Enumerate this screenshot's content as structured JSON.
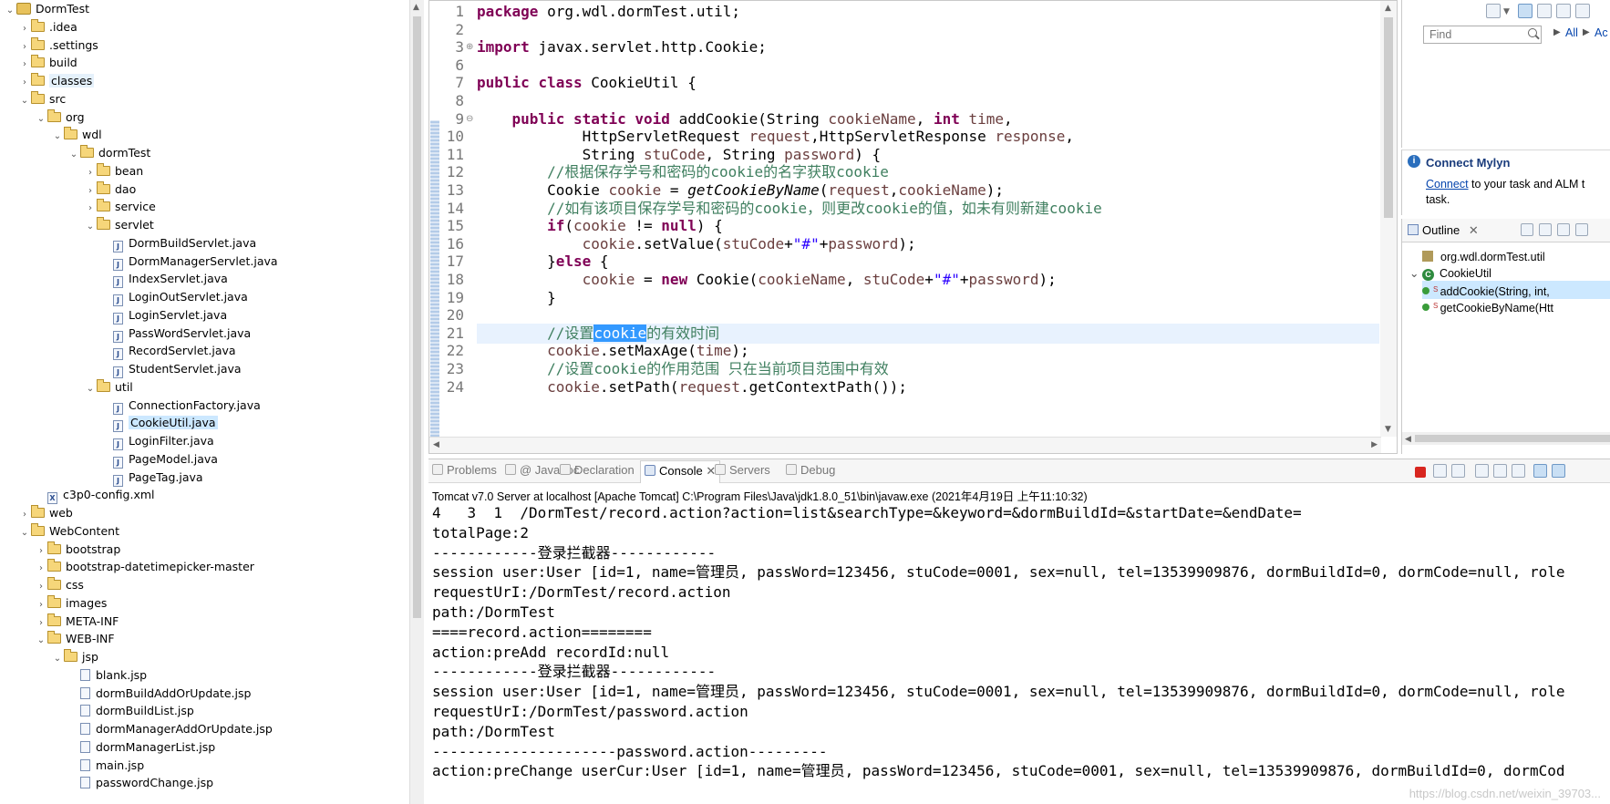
{
  "explorer": {
    "items": [
      {
        "label": "DormTest",
        "depth": 0,
        "type": "project",
        "expanded": true
      },
      {
        "label": ".idea",
        "depth": 1,
        "type": "folder",
        "expanded": false
      },
      {
        "label": ".settings",
        "depth": 1,
        "type": "folder",
        "expanded": false
      },
      {
        "label": "build",
        "depth": 1,
        "type": "folder",
        "expanded": false
      },
      {
        "label": "classes",
        "depth": 1,
        "type": "folder",
        "expanded": false,
        "highlight": true
      },
      {
        "label": "src",
        "depth": 1,
        "type": "folder",
        "expanded": true
      },
      {
        "label": "org",
        "depth": 2,
        "type": "folder",
        "expanded": true
      },
      {
        "label": "wdl",
        "depth": 3,
        "type": "folder",
        "expanded": true
      },
      {
        "label": "dormTest",
        "depth": 4,
        "type": "folder",
        "expanded": true
      },
      {
        "label": "bean",
        "depth": 5,
        "type": "folder",
        "expanded": false
      },
      {
        "label": "dao",
        "depth": 5,
        "type": "folder",
        "expanded": false
      },
      {
        "label": "service",
        "depth": 5,
        "type": "folder",
        "expanded": false
      },
      {
        "label": "servlet",
        "depth": 5,
        "type": "folder",
        "expanded": true
      },
      {
        "label": "DormBuildServlet.java",
        "depth": 6,
        "type": "java"
      },
      {
        "label": "DormManagerServlet.java",
        "depth": 6,
        "type": "java"
      },
      {
        "label": "IndexServlet.java",
        "depth": 6,
        "type": "java"
      },
      {
        "label": "LoginOutServlet.java",
        "depth": 6,
        "type": "java"
      },
      {
        "label": "LoginServlet.java",
        "depth": 6,
        "type": "java"
      },
      {
        "label": "PassWordServlet.java",
        "depth": 6,
        "type": "java"
      },
      {
        "label": "RecordServlet.java",
        "depth": 6,
        "type": "java"
      },
      {
        "label": "StudentServlet.java",
        "depth": 6,
        "type": "java"
      },
      {
        "label": "util",
        "depth": 5,
        "type": "folder",
        "expanded": true
      },
      {
        "label": "ConnectionFactory.java",
        "depth": 6,
        "type": "java"
      },
      {
        "label": "CookieUtil.java",
        "depth": 6,
        "type": "java",
        "selected": true
      },
      {
        "label": "LoginFilter.java",
        "depth": 6,
        "type": "java"
      },
      {
        "label": "PageModel.java",
        "depth": 6,
        "type": "java"
      },
      {
        "label": "PageTag.java",
        "depth": 6,
        "type": "java"
      },
      {
        "label": "c3p0-config.xml",
        "depth": 2,
        "type": "xml"
      },
      {
        "label": "web",
        "depth": 1,
        "type": "folder",
        "expanded": false
      },
      {
        "label": "WebContent",
        "depth": 1,
        "type": "folder",
        "expanded": true
      },
      {
        "label": "bootstrap",
        "depth": 2,
        "type": "folder",
        "expanded": false
      },
      {
        "label": "bootstrap-datetimepicker-master",
        "depth": 2,
        "type": "folder",
        "expanded": false
      },
      {
        "label": "css",
        "depth": 2,
        "type": "folder",
        "expanded": false
      },
      {
        "label": "images",
        "depth": 2,
        "type": "folder",
        "expanded": false
      },
      {
        "label": "META-INF",
        "depth": 2,
        "type": "folder",
        "expanded": false
      },
      {
        "label": "WEB-INF",
        "depth": 2,
        "type": "folder",
        "expanded": true
      },
      {
        "label": "jsp",
        "depth": 3,
        "type": "folder",
        "expanded": true
      },
      {
        "label": "blank.jsp",
        "depth": 4,
        "type": "jsp"
      },
      {
        "label": "dormBuildAddOrUpdate.jsp",
        "depth": 4,
        "type": "jsp"
      },
      {
        "label": "dormBuildList.jsp",
        "depth": 4,
        "type": "jsp"
      },
      {
        "label": "dormManagerAddOrUpdate.jsp",
        "depth": 4,
        "type": "jsp"
      },
      {
        "label": "dormManagerList.jsp",
        "depth": 4,
        "type": "jsp"
      },
      {
        "label": "main.jsp",
        "depth": 4,
        "type": "jsp"
      },
      {
        "label": "passwordChange.jsp",
        "depth": 4,
        "type": "jsp"
      }
    ]
  },
  "editor": {
    "line_numbers": [
      "1",
      "2",
      "3",
      "6",
      "7",
      "8",
      "9",
      "10",
      "11",
      "12",
      "13",
      "14",
      "15",
      "16",
      "17",
      "18",
      "19",
      "20",
      "21",
      "22",
      "23",
      "24"
    ],
    "lines": [
      [
        {
          "t": "package ",
          "c": "kw"
        },
        {
          "t": "org.wdl.dormTest.util;"
        }
      ],
      [],
      [
        {
          "t": "import ",
          "c": "kw"
        },
        {
          "t": "javax.servlet.http.Cookie;"
        }
      ],
      [],
      [
        {
          "t": "public ",
          "c": "kw"
        },
        {
          "t": "class ",
          "c": "kw"
        },
        {
          "t": "CookieUtil {"
        }
      ],
      [],
      [
        {
          "t": "    "
        },
        {
          "t": "public ",
          "c": "kw"
        },
        {
          "t": "static ",
          "c": "kw"
        },
        {
          "t": "void ",
          "c": "kw"
        },
        {
          "t": "addCookie(String "
        },
        {
          "t": "cookieName",
          "c": "var"
        },
        {
          "t": ", "
        },
        {
          "t": "int ",
          "c": "kw"
        },
        {
          "t": "time",
          "c": "var"
        },
        {
          "t": ","
        }
      ],
      [
        {
          "t": "            HttpServletRequest "
        },
        {
          "t": "request",
          "c": "var"
        },
        {
          "t": ",HttpServletResponse "
        },
        {
          "t": "response",
          "c": "var"
        },
        {
          "t": ","
        }
      ],
      [
        {
          "t": "            String "
        },
        {
          "t": "stuCode",
          "c": "var"
        },
        {
          "t": ", String "
        },
        {
          "t": "password",
          "c": "var"
        },
        {
          "t": ") {"
        }
      ],
      [
        {
          "t": "        "
        },
        {
          "t": "//根据保存学号和密码的cookie的名字获取cookie",
          "c": "cm"
        }
      ],
      [
        {
          "t": "        Cookie "
        },
        {
          "t": "cookie",
          "c": "var"
        },
        {
          "t": " = "
        },
        {
          "t": "getCookieByName",
          "c": "it"
        },
        {
          "t": "("
        },
        {
          "t": "request",
          "c": "var"
        },
        {
          "t": ","
        },
        {
          "t": "cookieName",
          "c": "var"
        },
        {
          "t": ");"
        }
      ],
      [
        {
          "t": "        "
        },
        {
          "t": "//如有该项目保存学号和密码的cookie，则更改cookie的值，如未有则新建cookie",
          "c": "cm"
        }
      ],
      [
        {
          "t": "        "
        },
        {
          "t": "if",
          "c": "kw"
        },
        {
          "t": "("
        },
        {
          "t": "cookie",
          "c": "var"
        },
        {
          "t": " != "
        },
        {
          "t": "null",
          "c": "kw"
        },
        {
          "t": ") {"
        }
      ],
      [
        {
          "t": "            "
        },
        {
          "t": "cookie",
          "c": "var"
        },
        {
          "t": ".setValue("
        },
        {
          "t": "stuCode",
          "c": "var"
        },
        {
          "t": "+"
        },
        {
          "t": "\"#\"",
          "c": "str"
        },
        {
          "t": "+"
        },
        {
          "t": "password",
          "c": "var"
        },
        {
          "t": ");"
        }
      ],
      [
        {
          "t": "        }"
        },
        {
          "t": "else ",
          "c": "kw"
        },
        {
          "t": "{"
        }
      ],
      [
        {
          "t": "            "
        },
        {
          "t": "cookie",
          "c": "var"
        },
        {
          "t": " = "
        },
        {
          "t": "new ",
          "c": "kw"
        },
        {
          "t": "Cookie("
        },
        {
          "t": "cookieName",
          "c": "var"
        },
        {
          "t": ", "
        },
        {
          "t": "stuCode",
          "c": "var"
        },
        {
          "t": "+"
        },
        {
          "t": "\"#\"",
          "c": "str"
        },
        {
          "t": "+"
        },
        {
          "t": "password",
          "c": "var"
        },
        {
          "t": ");"
        }
      ],
      [
        {
          "t": "        }"
        }
      ],
      [],
      [
        {
          "t": "        "
        },
        {
          "t": "//设置",
          "c": "cm"
        },
        {
          "t": "cookie",
          "c": "sel"
        },
        {
          "t": "的有效时间",
          "c": "cm"
        }
      ],
      [
        {
          "t": "        "
        },
        {
          "t": "cookie",
          "c": "var"
        },
        {
          "t": ".setMaxAge("
        },
        {
          "t": "time",
          "c": "var"
        },
        {
          "t": ");"
        }
      ],
      [
        {
          "t": "        "
        },
        {
          "t": "//设置cookie的作用范围 只在当前项目范围中有效",
          "c": "cm"
        }
      ],
      [
        {
          "t": "        "
        },
        {
          "t": "cookie",
          "c": "var"
        },
        {
          "t": ".setPath("
        },
        {
          "t": "request",
          "c": "var"
        },
        {
          "t": ".getContextPath());"
        }
      ]
    ]
  },
  "tasklist": {
    "find_placeholder": "Find",
    "all_label": "All",
    "activate_label": "Ac"
  },
  "mylyn": {
    "title": "Connect Mylyn",
    "link": "Connect",
    "text": " to your task and ALM t",
    "text2": "task."
  },
  "outline": {
    "tab_label": "Outline",
    "items": [
      {
        "label": "org.wdl.dormTest.util",
        "kind": "package"
      },
      {
        "label": "CookieUtil",
        "kind": "class"
      },
      {
        "label": "addCookie(String, int,",
        "kind": "method",
        "selected": true
      },
      {
        "label": "getCookieByName(Htt",
        "kind": "method"
      }
    ]
  },
  "console": {
    "tabs": [
      {
        "label": "Problems",
        "active": false
      },
      {
        "label": "@ Javadoc",
        "active": false
      },
      {
        "label": "Declaration",
        "active": false
      },
      {
        "label": "Console",
        "active": true
      },
      {
        "label": "Servers",
        "active": false
      },
      {
        "label": "Debug",
        "active": false
      }
    ],
    "header": "Tomcat v7.0 Server at localhost [Apache Tomcat] C:\\Program Files\\Java\\jdk1.8.0_51\\bin\\javaw.exe (2021年4月19日 上午11:10:32)",
    "lines": [
      "4   3  1  /DormTest/record.action?action=list&searchType=&keyword=&dormBuildId=&startDate=&endDate=",
      "totalPage:2",
      "------------登录拦截器------------",
      "session user:User [id=1, name=管理员, passWord=123456, stuCode=0001, sex=null, tel=13539909876, dormBuildId=0, dormCode=null, role",
      "requestUrI:/DormTest/record.action",
      "path:/DormTest",
      "====record.action========",
      "action:preAdd recordId:null",
      "------------登录拦截器------------",
      "session user:User [id=1, name=管理员, passWord=123456, stuCode=0001, sex=null, tel=13539909876, dormBuildId=0, dormCode=null, role",
      "requestUrI:/DormTest/password.action",
      "path:/DormTest",
      "---------------------password.action---------",
      "action:preChange userCur:User [id=1, name=管理员, passWord=123456, stuCode=0001, sex=null, tel=13539909876, dormBuildId=0, dormCod"
    ],
    "watermark": "https://blog.csdn.net/weixin_39703..."
  }
}
